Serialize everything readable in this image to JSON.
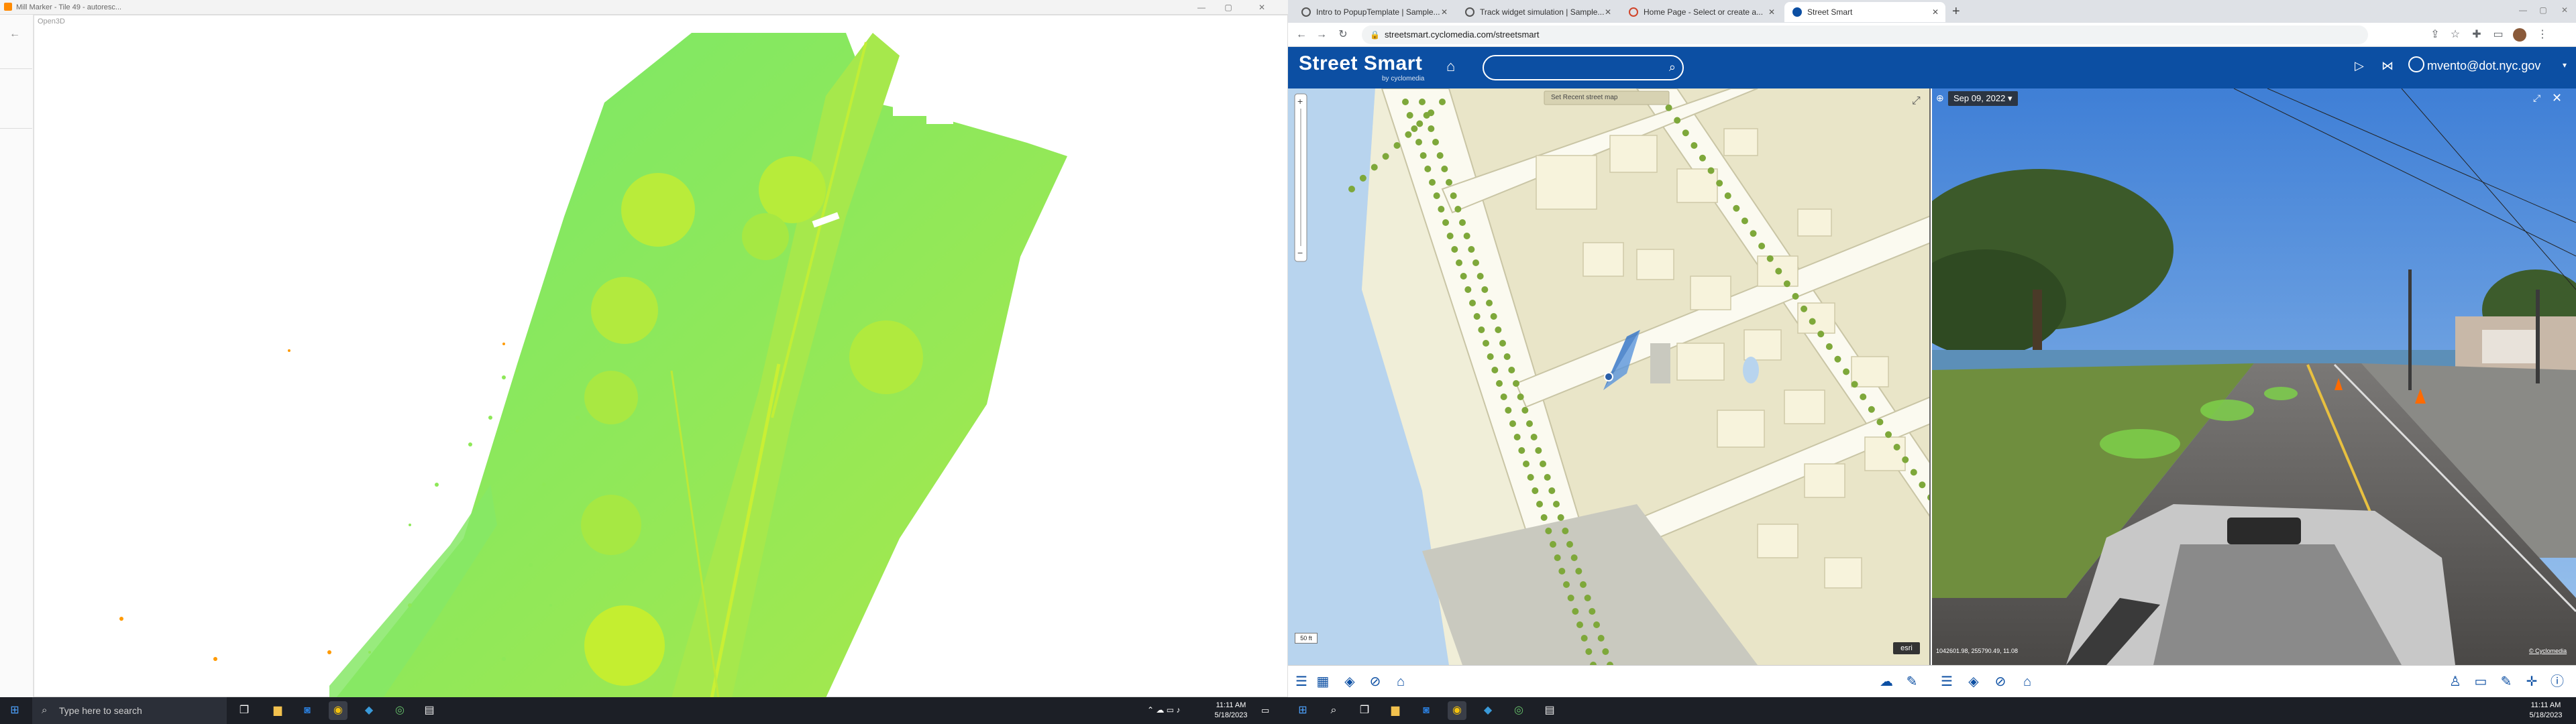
{
  "left_window": {
    "tab_title": "Mill Marker - Tile 49 - autoresc...",
    "viewer_title": "Open3D"
  },
  "browser": {
    "tabs": [
      {
        "title": "Intro to PopupTemplate | Sample..."
      },
      {
        "title": "Track widget simulation | Sample..."
      },
      {
        "title": "Home Page - Select or create a..."
      },
      {
        "title": "Street Smart"
      }
    ],
    "new_tab": "+",
    "url": "streetsmart.cyclomedia.com/streetsmart"
  },
  "street_smart": {
    "logo": "Street Smart",
    "logo_sub": "by cyclomedia",
    "search_placeholder": "",
    "user": "mvento@dot.nyc.gov",
    "map_top_label": "Set Recent street map",
    "map_scale": "50 ft",
    "map_esri": "esri",
    "pano_date": "Sep 09, 2022",
    "pano_coords": "1042601.98, 255790.49, 11.08",
    "pano_copyright": "© Cyclomedia"
  },
  "taskbar": {
    "search_placeholder": "Type here to search",
    "left_time": "11:11 AM",
    "left_date": "5/18/2023",
    "right_time": "11:11 AM",
    "right_date": "5/18/2023"
  }
}
